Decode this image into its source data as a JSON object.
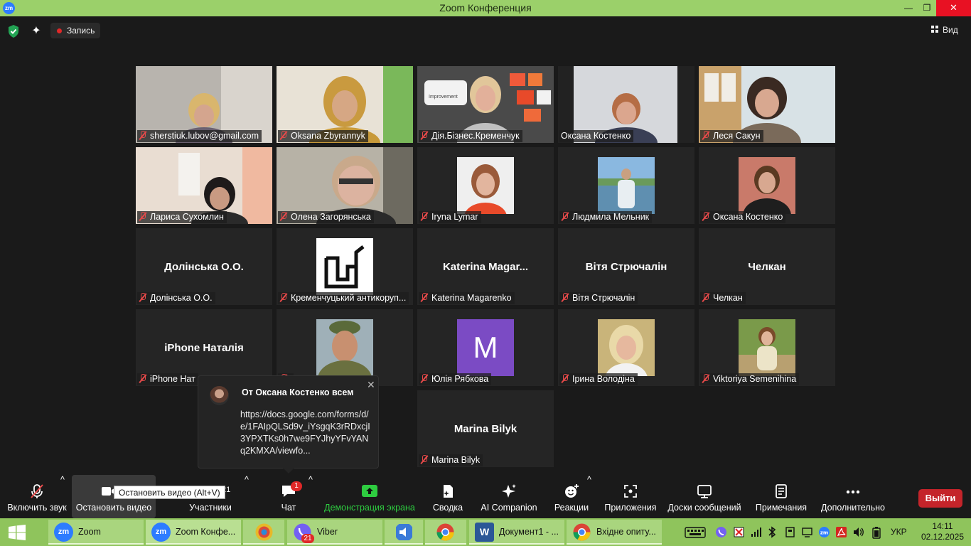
{
  "window": {
    "logo_text": "zm",
    "title": "Zoom Конференция",
    "min_glyph": "—",
    "max_glyph": "❐",
    "close_glyph": "✕"
  },
  "topbar": {
    "record_label": "Запись",
    "view_label": "Вид"
  },
  "participants": [
    {
      "label": "sherstiuk.lubov@gmail.com",
      "video": true
    },
    {
      "label": "Oksana Zbyrannyk",
      "video": true
    },
    {
      "label": "Дія.Бізнес.Кременчук",
      "video": true,
      "poster_text": "Improvement"
    },
    {
      "label": "Оксана Костенко",
      "video": true,
      "active_speaker": true
    },
    {
      "label": "Леся Сакун",
      "video": true
    },
    {
      "label": "Лариса Сухомлин",
      "video": true
    },
    {
      "label": "Олена Загорянська",
      "video": true
    },
    {
      "label": "Iryna Lymar",
      "video": false,
      "avatar": true
    },
    {
      "label": "Людмила Мельник",
      "video": false,
      "avatar": true
    },
    {
      "label": "Оксана Костенко",
      "video": false,
      "avatar": true
    },
    {
      "label": "Долінська О.О.",
      "video": false,
      "display_name": "Долінська О.О."
    },
    {
      "label": "Кременчуцький антикоруп...",
      "video": false,
      "avatar": true,
      "logo": true
    },
    {
      "label": "Katerina Magarenko",
      "video": false,
      "display_name": "Katerina  Magar..."
    },
    {
      "label": "Вітя Стрючалін",
      "video": false,
      "display_name": "Вітя Стрючалін"
    },
    {
      "label": "Челкан",
      "video": false,
      "display_name": "Челкан"
    },
    {
      "label": "iPhone Нат",
      "video": false,
      "display_name": "iPhone Наталія"
    },
    {
      "label": "",
      "video": false,
      "avatar": true
    },
    {
      "label": "Юлія Рябкова",
      "video": false,
      "avatar": true,
      "letter": "M",
      "letter_color": "#7b4bc4"
    },
    {
      "label": "Ірина Володіна",
      "video": false,
      "avatar": true
    },
    {
      "label": "Viktoriya Semenihina",
      "video": false,
      "avatar": true
    },
    {
      "label": "Marina Bilyk",
      "video": false,
      "display_name": "Marina Bilyk"
    }
  ],
  "chat_popup": {
    "from": "От Оксана Костенко всем",
    "message": "https://docs.google.com/forms/d/e/1FAIpQLSd9v_iYsgqK3rRDxcjI3YPXTKs0h7we9FYJhyYFvYANq2KMXA/viewfo...",
    "close_glyph": "✕"
  },
  "toolbar": {
    "unmute_label": "Включить звук",
    "stop_video_label": "Остановить видео",
    "stop_video_tooltip": "Остановить видео (Alt+V)",
    "participants_label": "Участники",
    "participants_count": "21",
    "chat_label": "Чат",
    "chat_badge": "1",
    "share_label": "Демонстрация экрана",
    "summary_label": "Сводка",
    "ai_label": "AI Companion",
    "reactions_label": "Реакции",
    "apps_label": "Приложения",
    "whiteboards_label": "Доски сообщений",
    "notes_label": "Примечания",
    "more_label": "Дополнительно",
    "leave_label": "Выйти",
    "caret": "^"
  },
  "taskbar": {
    "items": [
      {
        "label": "Zoom",
        "icon_text": "zm"
      },
      {
        "label": "Zoom Конфе...",
        "icon_text": "zm"
      },
      {
        "label": ""
      },
      {
        "label": "Viber",
        "badge": "21"
      },
      {
        "label": ""
      },
      {
        "label": ""
      },
      {
        "label": "Документ1 - ...",
        "icon_text": "W"
      },
      {
        "label": "Вхідне опиту..."
      }
    ],
    "lang": "УКР",
    "time": "14:11",
    "date": "02.12.2025"
  },
  "colors": {
    "titlebar": "#9bd06a",
    "taskbar": "#8fc45c",
    "active_speaker_border": "#e6e98a",
    "leave": "#c4242a",
    "share_green": "#2ecc40"
  }
}
